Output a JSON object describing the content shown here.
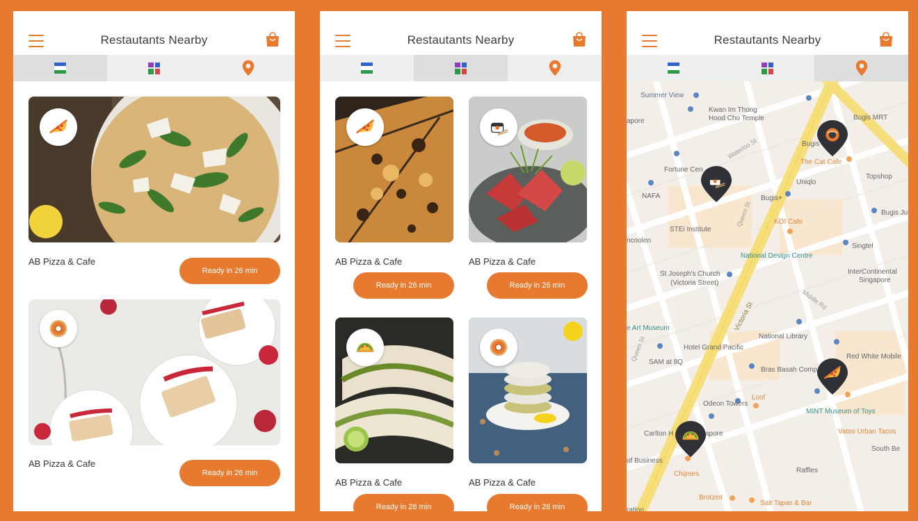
{
  "app": {
    "title": "Restautants Nearby",
    "accent": "#e87a2f"
  },
  "tabs": [
    {
      "name": "list-view",
      "icon": "list-icon"
    },
    {
      "name": "grid-view",
      "icon": "grid-icon"
    },
    {
      "name": "map-view",
      "icon": "map-pin-icon"
    }
  ],
  "screens": {
    "list": {
      "active_tab": "list-view",
      "cards": [
        {
          "name": "AB Pizza & Cafe",
          "cta": "Ready in 26 min",
          "food_icon": "pizza-icon",
          "photo": "pizza-salad-photo"
        },
        {
          "name": "AB Pizza & Cafe",
          "cta": "Ready in 26 min",
          "food_icon": "donut-icon",
          "photo": "cake-photo"
        }
      ]
    },
    "grid": {
      "active_tab": "grid-view",
      "cards": [
        {
          "name": "AB Pizza & Cafe",
          "cta": "Ready in 26 min",
          "food_icon": "pizza-icon",
          "photo": "pizza-photo"
        },
        {
          "name": "AB Pizza & Cafe",
          "cta": "Ready in 26 min",
          "food_icon": "sushi-icon",
          "photo": "tuna-photo"
        },
        {
          "name": "AB Pizza & Cafe",
          "cta": "Ready in 26 min",
          "food_icon": "taco-icon",
          "photo": "tacos-photo"
        },
        {
          "name": "AB Pizza & Cafe",
          "cta": "Ready in 26 min",
          "food_icon": "donut-icon",
          "photo": "cookies-photo"
        }
      ]
    },
    "map": {
      "active_tab": "map-view",
      "labels": [
        "Summer View",
        "Kwan Im Thong",
        "Hood Cho Temple",
        "Bugis MRT",
        "apore",
        "Bugis Street",
        "Waterloo St",
        "Fortune Cen",
        "The Cat Cafe",
        "Topshop",
        "Uniqlo",
        "NAFA",
        "Bugis+",
        "Bugis Jun",
        "KOI Cafe",
        "STEi Institute",
        "Queen St",
        "ncoolen",
        "Singtel",
        "National Design Centre",
        "St Joseph's Church",
        "(Victoria Street)",
        "InterContinental",
        "Singapore",
        "Middle Rd",
        "Victoria St",
        "e Art Museum",
        "National Library",
        "Queen St",
        "Hotel Grand Pacific",
        "Red White Mobile",
        "SAM at 8Q",
        "Bras Basah Comp",
        "Loof",
        "Odeon Towers",
        "MINT Museum of Toys",
        "Carlton H",
        "apore",
        "Vatos Urban Tacos",
        "South Be",
        "of Business",
        "Chijmes",
        "Raffles",
        "Brotzeit",
        "Salt Tapas & Bar",
        "ration"
      ],
      "markers": [
        "ramen-marker-icon",
        "sushi-marker-icon",
        "pizza-marker-icon",
        "taco-marker-icon"
      ]
    }
  }
}
